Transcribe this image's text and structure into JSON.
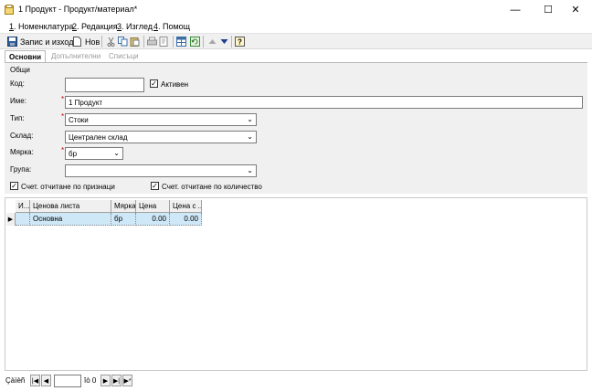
{
  "window": {
    "title": "1 Продукт - Продукт/материал*",
    "minimize": "—",
    "maximize": "☐",
    "close": "✕"
  },
  "menu": {
    "items": [
      {
        "key": "1",
        "label": ". Номенклатура"
      },
      {
        "key": "2",
        "label": ". Редакция"
      },
      {
        "key": "3",
        "label": ". Изглед"
      },
      {
        "key": "4",
        "label": ". Помощ"
      }
    ]
  },
  "toolbar": {
    "save_label": "Запис и изход",
    "new_label": "Нов"
  },
  "tabs": [
    {
      "label": "Основни"
    },
    {
      "label": "Допълнителни"
    },
    {
      "label": "Списъци"
    }
  ],
  "form": {
    "group_title": "Общи",
    "code_label": "Код:",
    "code_value": "",
    "active_label": "Активен",
    "active_checked": true,
    "name_label": "Име:",
    "name_value": "1 Продукт",
    "type_label": "Тип:",
    "type_value": "Стоки",
    "warehouse_label": "Склад:",
    "warehouse_value": "Централен склад",
    "unit_label": "Мярка:",
    "unit_value": "бр",
    "group_label": "Група:",
    "group_value": "",
    "by_attributes_label": "Счет. отчитане по признаци",
    "by_attributes_checked": true,
    "by_quantity_label": "Счет. отчитане по количество",
    "by_quantity_checked": true
  },
  "grid": {
    "columns": [
      "И...",
      "Ценова листа",
      "Мярка",
      "Цена",
      "Цена с ..."
    ],
    "rows": [
      {
        "id": "",
        "price_list": "Основна",
        "unit": "бр",
        "price": "0.00",
        "price_with": "0.00"
      }
    ]
  },
  "navigator": {
    "record_label": "Çàïèñ",
    "of_label": "îò 0"
  },
  "colors": {
    "accent_blue": "#1e5aa8",
    "row_selected": "#cfe8f7",
    "required_star": "#c00000"
  }
}
